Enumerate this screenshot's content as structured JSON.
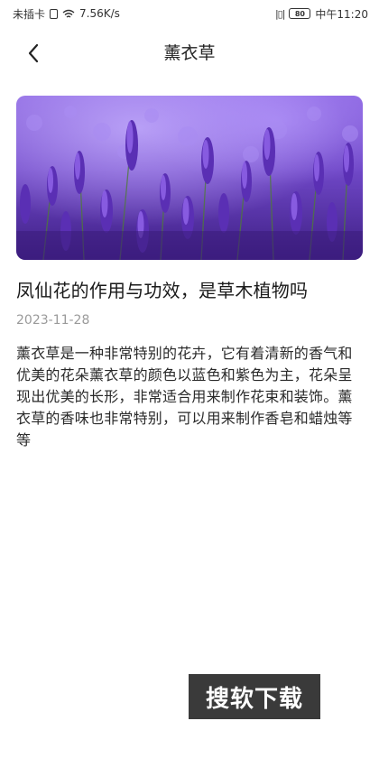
{
  "status_bar": {
    "carrier": "未插卡",
    "speed": "7.56K/s",
    "battery": "80",
    "time": "中午11:20"
  },
  "nav": {
    "title": "薰衣草"
  },
  "hero_image": {
    "subject": "lavender field"
  },
  "article": {
    "title": "凤仙花的作用与功效，是草木植物吗",
    "date": "2023-11-28",
    "body": "薰衣草是一种非常特别的花卉，它有着清新的香气和优美的花朵薰衣草的颜色以蓝色和紫色为主，花朵呈现出优美的长形，非常适合用来制作花束和装饰。薰衣草的香味也非常特别，可以用来制作香皂和蜡烛等等"
  },
  "watermark": {
    "text": "搜软下载"
  },
  "colors": {
    "background": "#ffffff",
    "text_primary": "#222222",
    "text_secondary": "#9a9a9a",
    "lavender": "#7b4fc9"
  }
}
